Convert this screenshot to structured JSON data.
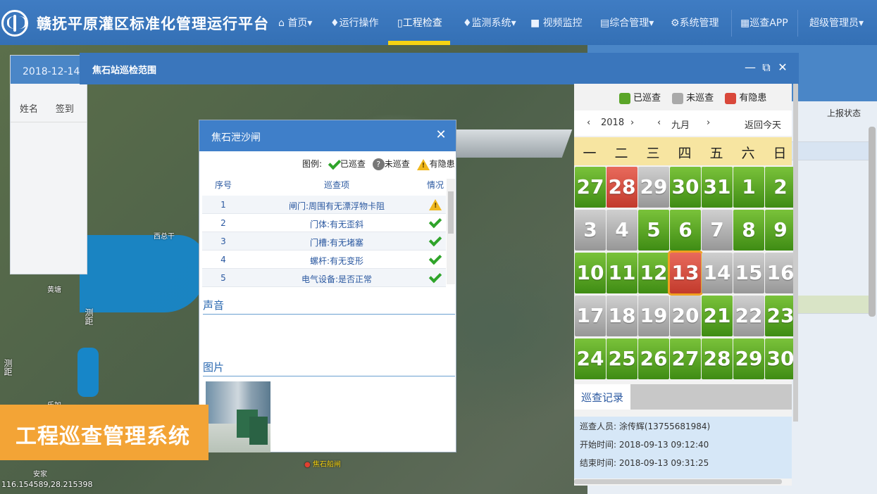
{
  "app": {
    "title": "赣抚平原灌区标准化管理运行平台"
  },
  "nav": [
    {
      "label": "首页",
      "icon": "home-icon",
      "dropdown": true
    },
    {
      "label": "运行操作",
      "icon": "drop-icon",
      "dropdown": false
    },
    {
      "label": "工程检查",
      "icon": "doc-icon",
      "dropdown": false,
      "active": true
    },
    {
      "label": "监测系统",
      "icon": "drop-icon",
      "dropdown": true
    },
    {
      "label": "视频监控",
      "icon": "video-icon",
      "dropdown": false
    },
    {
      "label": "综合管理",
      "icon": "file-icon",
      "dropdown": true
    },
    {
      "label": "系统管理",
      "icon": "gear-icon",
      "dropdown": false
    },
    {
      "label": "巡查APP",
      "icon": "qr-icon",
      "dropdown": false
    },
    {
      "label": "超级管理员",
      "icon": "",
      "dropdown": true
    }
  ],
  "bg_left": {
    "date": "2018-12-14 签",
    "col_name": "姓名",
    "col_sign": "签到"
  },
  "bg_right": {
    "col_status": "上报状态"
  },
  "map": {
    "labels": [
      "西总干",
      "测距",
      "测距",
      "黄塘",
      "乐加",
      "安家",
      "焦石船闸"
    ],
    "coords": "116.154589,28.215398"
  },
  "window": {
    "title": "焦石站巡检范围"
  },
  "dialog": {
    "title": "焦石泄沙闸",
    "legend": {
      "label": "图例:",
      "done": "已巡查",
      "not_done": "未巡查",
      "hazard": "有隐患"
    },
    "table": {
      "headers": [
        "序号",
        "巡查项",
        "情况"
      ],
      "rows": [
        {
          "no": "1",
          "item": "闸门:周围有无漂浮物卡阻",
          "status": "hazard"
        },
        {
          "no": "2",
          "item": "门体:有无歪斜",
          "status": "ok"
        },
        {
          "no": "3",
          "item": "门槽:有无堵塞",
          "status": "ok"
        },
        {
          "no": "4",
          "item": "螺杆:有无变形",
          "status": "ok"
        },
        {
          "no": "5",
          "item": "电气设备:是否正常",
          "status": "ok"
        }
      ]
    },
    "sound_label": "声音",
    "picture_label": "图片"
  },
  "calendar": {
    "legend": {
      "done": "已巡查",
      "not_done": "未巡查",
      "hazard": "有隐患"
    },
    "colors": {
      "done": "#5aa528",
      "not_done": "#a9a9a9",
      "hazard": "#d9483b"
    },
    "year": "2018",
    "month": "九月",
    "today_btn": "返回今天",
    "weekdays": [
      "一",
      "二",
      "三",
      "四",
      "五",
      "六",
      "日"
    ],
    "days": [
      {
        "d": "27",
        "s": "g"
      },
      {
        "d": "28",
        "s": "r"
      },
      {
        "d": "29",
        "s": "n"
      },
      {
        "d": "30",
        "s": "g"
      },
      {
        "d": "31",
        "s": "g"
      },
      {
        "d": "1",
        "s": "g"
      },
      {
        "d": "2",
        "s": "g"
      },
      {
        "d": "3",
        "s": "n"
      },
      {
        "d": "4",
        "s": "n"
      },
      {
        "d": "5",
        "s": "g"
      },
      {
        "d": "6",
        "s": "g"
      },
      {
        "d": "7",
        "s": "n"
      },
      {
        "d": "8",
        "s": "g"
      },
      {
        "d": "9",
        "s": "g"
      },
      {
        "d": "10",
        "s": "g"
      },
      {
        "d": "11",
        "s": "g"
      },
      {
        "d": "12",
        "s": "g"
      },
      {
        "d": "13",
        "s": "r",
        "today": true
      },
      {
        "d": "14",
        "s": "n"
      },
      {
        "d": "15",
        "s": "n"
      },
      {
        "d": "16",
        "s": "n"
      },
      {
        "d": "17",
        "s": "n"
      },
      {
        "d": "18",
        "s": "n"
      },
      {
        "d": "19",
        "s": "n"
      },
      {
        "d": "20",
        "s": "n"
      },
      {
        "d": "21",
        "s": "g"
      },
      {
        "d": "22",
        "s": "n"
      },
      {
        "d": "23",
        "s": "g"
      },
      {
        "d": "24",
        "s": "g"
      },
      {
        "d": "25",
        "s": "g"
      },
      {
        "d": "26",
        "s": "g"
      },
      {
        "d": "27",
        "s": "g"
      },
      {
        "d": "28",
        "s": "g"
      },
      {
        "d": "29",
        "s": "g"
      },
      {
        "d": "30",
        "s": "g"
      }
    ],
    "record_tab": "巡查记录",
    "record": [
      "巡查人员: 涂传辉(13755681984)",
      "开始时间: 2018-09-13 09:12:40",
      "结束时间: 2018-09-13 09:31:25"
    ]
  },
  "banner": "工程巡查管理系统"
}
